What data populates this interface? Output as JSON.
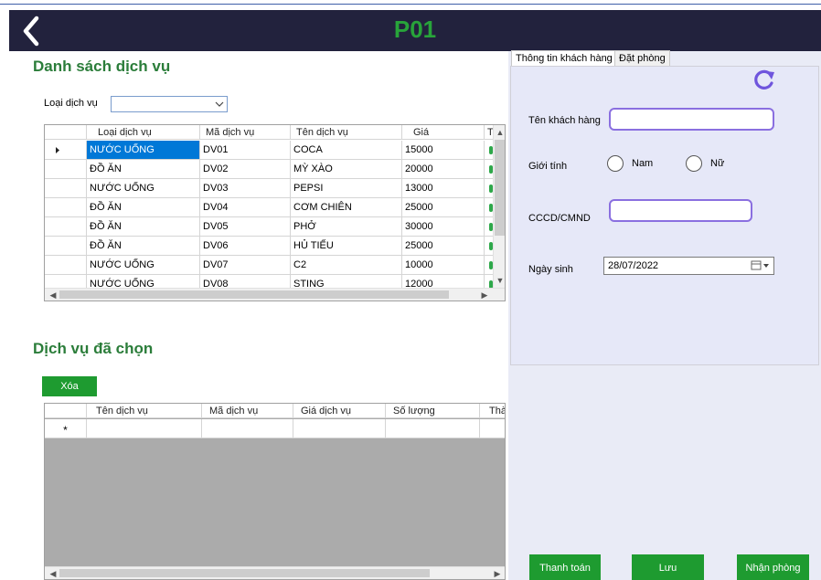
{
  "header": {
    "title": "P01"
  },
  "services": {
    "title": "Danh sách dịch vụ",
    "filter_label": "Loại dịch vụ",
    "filter_value": "",
    "columns": [
      "Loại dịch vụ",
      "Mã dịch vụ",
      "Tên dịch vụ",
      "Giá",
      "Th"
    ],
    "rows": [
      [
        "NƯỚC UỐNG",
        "DV01",
        "COCA",
        "15000"
      ],
      [
        "ĐỒ ĂN",
        "DV02",
        "MỲ XÀO",
        "20000"
      ],
      [
        "NƯỚC UỐNG",
        "DV03",
        "PEPSI",
        "13000"
      ],
      [
        "ĐỒ ĂN",
        "DV04",
        "CƠM CHIÊN",
        "25000"
      ],
      [
        "ĐỒ ĂN",
        "DV05",
        "PHỞ",
        "30000"
      ],
      [
        "ĐỒ ĂN",
        "DV06",
        "HỦ TIẾU",
        "25000"
      ],
      [
        "NƯỚC UỐNG",
        "DV07",
        "C2",
        "10000"
      ],
      [
        "NƯỚC UỐNG",
        "DV08",
        "STING",
        "12000"
      ]
    ]
  },
  "selected": {
    "title": "Dịch vụ đã chọn",
    "delete_label": "Xóa",
    "columns": [
      "Tên dịch vụ",
      "Mã dịch vụ",
      "Giá dịch vụ",
      "Số lượng",
      "Thà"
    ],
    "new_row_marker": "*"
  },
  "tabs": [
    "Thông tin khách hàng",
    "Đặt phòng"
  ],
  "customer": {
    "name_label": "Tên khách hàng",
    "name_value": "",
    "gender_label": "Giới tính",
    "gender_options": [
      "Nam",
      "Nữ"
    ],
    "id_label": "CCCD/CMND",
    "id_value": "",
    "dob_label": "Ngày sinh",
    "dob_value": "28/07/2022"
  },
  "actions": {
    "pay": "Thanh toán",
    "save": "Lưu",
    "checkin": "Nhận phòng"
  },
  "colors": {
    "header_bg": "#22223d",
    "title_green": "#28a43a",
    "button_green": "#1e9b30",
    "panel_bg": "#e9ebf6",
    "selection": "#0078d7"
  },
  "icons": [
    "back-arrow-icon",
    "refresh-icon",
    "calendar-icon",
    "chevron-down-icon",
    "row-pointer-icon"
  ]
}
